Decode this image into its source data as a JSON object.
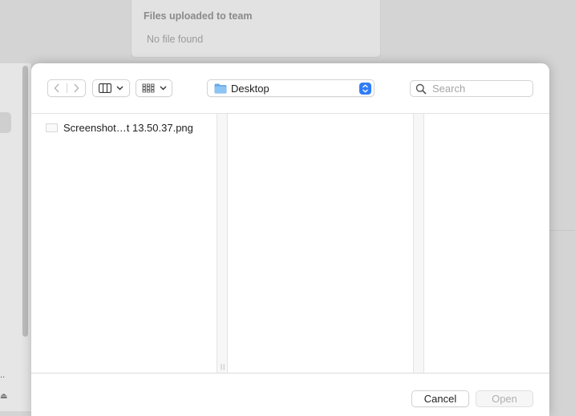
{
  "background": {
    "card_title": "Files uploaded to team",
    "card_empty_text": "No file found"
  },
  "sidebar": {
    "truncated_label": "..",
    "eject_glyph": "⏏"
  },
  "toolbar": {
    "back_icon": "chevron-left-icon",
    "forward_icon": "chevron-right-icon",
    "view_mode_icon": "column-view-icon",
    "group_icon": "grid-group-icon",
    "location": "Desktop",
    "search_placeholder": "Search",
    "search_value": ""
  },
  "browser": {
    "files": [
      {
        "name": "Screenshot…t 13.50.37.png"
      }
    ],
    "resize_grip": "||"
  },
  "footer": {
    "cancel_label": "Cancel",
    "open_label": "Open"
  },
  "colors": {
    "accent": "#2f7cf6",
    "folder": "#6fb2ee"
  }
}
